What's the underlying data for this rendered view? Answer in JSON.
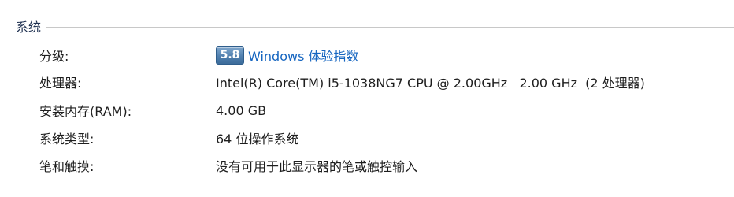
{
  "section": {
    "title": "系统"
  },
  "rows": [
    {
      "label": "分级:",
      "score": "5.8",
      "link_text": "Windows 体验指数"
    },
    {
      "label": "处理器:",
      "value": "Intel(R) Core(TM) i5-1038NG7 CPU @ 2.00GHz   2.00 GHz  (2 处理器)"
    },
    {
      "label": "安装内存(RAM):",
      "value": "4.00 GB"
    },
    {
      "label": "系统类型:",
      "value": "64 位操作系统"
    },
    {
      "label": "笔和触摸:",
      "value": "没有可用于此显示器的笔或触控输入"
    }
  ],
  "colors": {
    "link": "#1565c0",
    "badge": "#4f7fae",
    "heading": "#1e3050"
  }
}
